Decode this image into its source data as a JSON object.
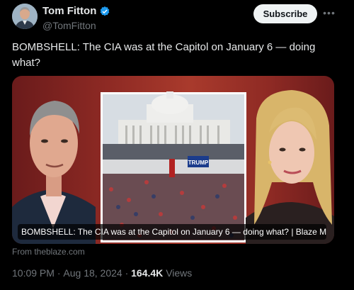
{
  "author": {
    "name": "Tom Fitton",
    "handle": "@TomFitton",
    "verified": true
  },
  "subscribe_label": "Subscribe",
  "more_icon": "more-icon",
  "post": {
    "text": "BOMBSHELL: The CIA was at the Capitol on January 6 — doing what?"
  },
  "media": {
    "caption": "BOMBSHELL: The CIA was at the Capitol on January 6 — doing what? | Blaze Me...",
    "source": "From theblaze.com",
    "sign_text": "TRUMP"
  },
  "meta": {
    "time": "10:09 PM",
    "separator": " · ",
    "date": "Aug 18, 2024",
    "views_count": "164.4K",
    "views_label": "Views"
  },
  "colors": {
    "background": "#000000",
    "verified": "#1d9bf0",
    "muted": "#71767b",
    "text": "#e7e9ea"
  }
}
